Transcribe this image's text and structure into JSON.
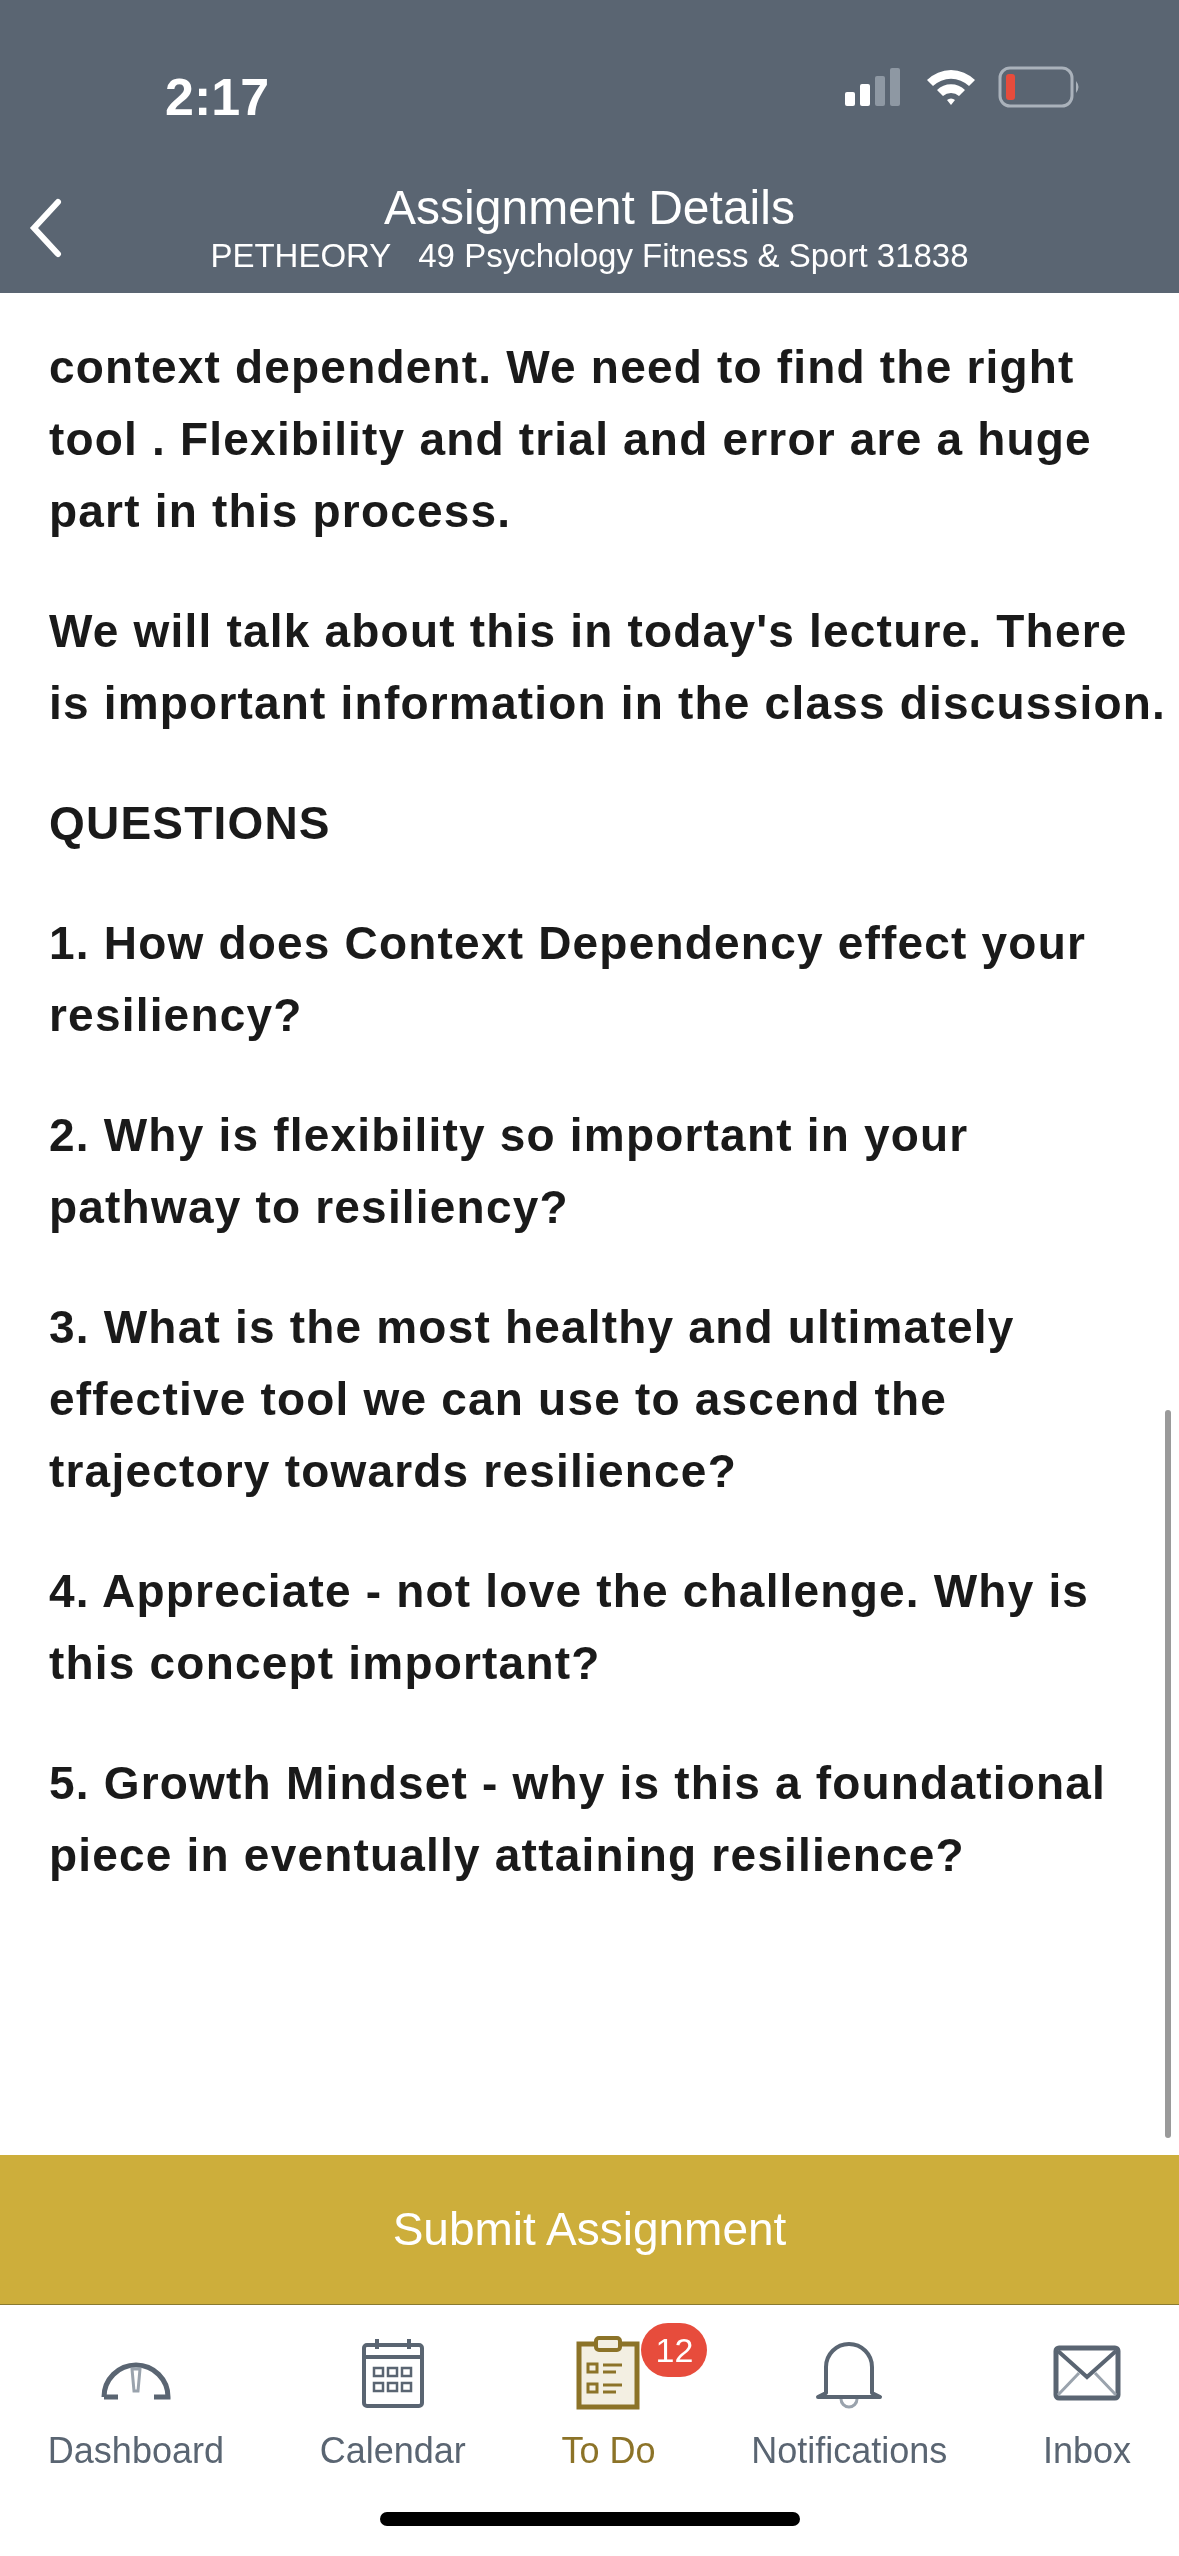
{
  "status_bar": {
    "time": "2:17"
  },
  "header": {
    "title": "Assignment Details",
    "subtitle": "PETHEORY   49 Psychology Fitness & Sport 31838"
  },
  "paragraphs": [
    {
      "text": "context dependent. We need to find the right tool . Flexibility and trial and error are a huge part in this process."
    },
    {
      "text": "We will talk about this in today's lecture. There is important information in the class discussion."
    },
    {
      "text": "QUESTIONS"
    },
    {
      "text": "1. How does Context Dependency effect your resiliency?"
    },
    {
      "text": "2. Why is flexibility so important in your pathway to resiliency?"
    },
    {
      "text": "3. What is the most healthy and ultimately effective tool we can use to ascend the trajectory towards resilience?"
    },
    {
      "text": "4. Appreciate - not love the challenge. Why is this concept important?"
    },
    {
      "text": "5. Growth Mindset - why is this a foundational piece in eventually attaining resilience?"
    }
  ],
  "submit_button": "Submit Assignment",
  "tabs": [
    {
      "kind": "dashboard",
      "label": "Dashboard",
      "selected": false
    },
    {
      "kind": "calendar",
      "label": "Calendar",
      "selected": false
    },
    {
      "kind": "todo",
      "label": "To Do",
      "selected": true,
      "badge": "12"
    },
    {
      "kind": "notifications",
      "label": "Notifications",
      "selected": false
    },
    {
      "kind": "inbox",
      "label": "Inbox",
      "selected": false
    }
  ]
}
